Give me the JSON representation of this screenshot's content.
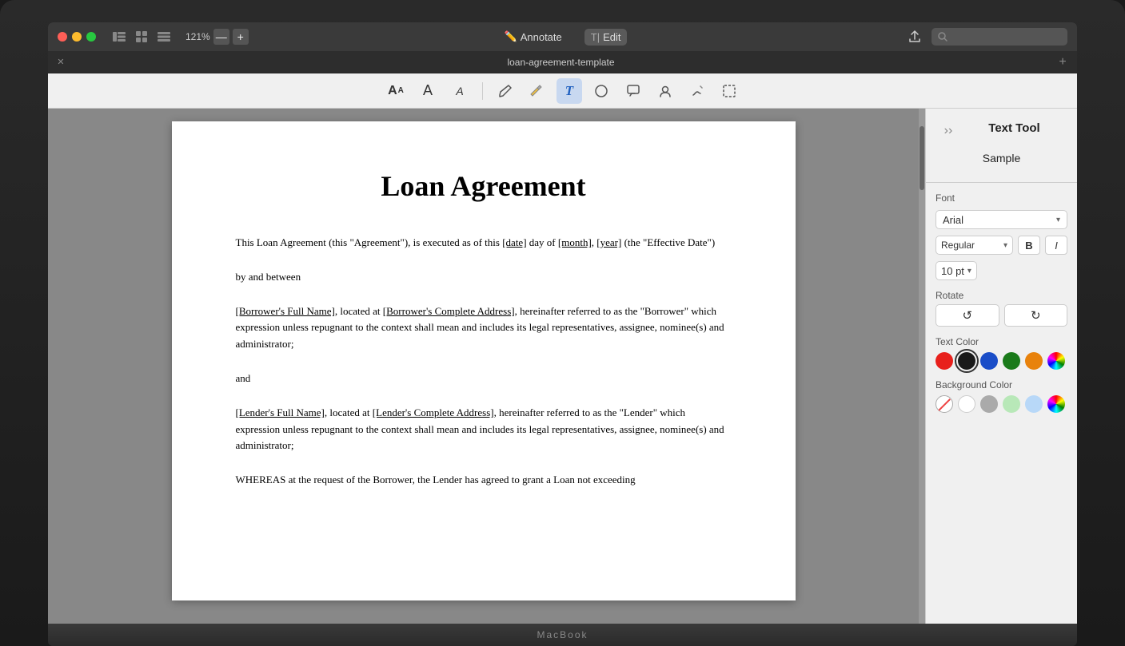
{
  "laptop": {
    "label": "MacBook"
  },
  "titlebar": {
    "zoom_level": "121%",
    "zoom_minus": "—",
    "zoom_plus": "+",
    "annotate_label": "Annotate",
    "edit_label": "Edit",
    "search_placeholder": ""
  },
  "tabbar": {
    "title": "loan-agreement-template",
    "close_label": "✕",
    "add_label": "+"
  },
  "toolbar": {
    "tools": [
      {
        "name": "text-resize-a-icon",
        "symbol": "𝗔",
        "active": false
      },
      {
        "name": "text-a-icon",
        "symbol": "A",
        "active": false
      },
      {
        "name": "text-a-small-icon",
        "symbol": "A",
        "active": false
      },
      {
        "name": "pencil-icon",
        "symbol": "✏",
        "active": false
      },
      {
        "name": "highlighter-icon",
        "symbol": "🖊",
        "active": false
      },
      {
        "name": "text-t-icon",
        "symbol": "T",
        "active": true
      },
      {
        "name": "shapes-icon",
        "symbol": "⬜",
        "active": false
      },
      {
        "name": "comment-icon",
        "symbol": "💬",
        "active": false
      },
      {
        "name": "signature-icon",
        "symbol": "👤",
        "active": false
      },
      {
        "name": "pen-icon",
        "symbol": "✒",
        "active": false
      },
      {
        "name": "selection-icon",
        "symbol": "⊡",
        "active": false
      }
    ]
  },
  "document": {
    "title": "Loan Agreement",
    "paragraphs": [
      {
        "text": "This Loan Agreement (this \"Agreement\"), is executed as of this [date] day of [month], [year] (the \"Effective Date\")",
        "has_underline": [
          "[date]",
          "[month]",
          "[year]"
        ]
      },
      {
        "text": "by and between"
      },
      {
        "text": "[Borrower's Full Name], located at [Borrower's Complete Address], hereinafter referred to as the \"Borrower\" which expression unless repugnant to the context shall mean and includes its legal representatives, assignee, nominee(s) and administrator;",
        "has_underline": [
          "[Borrower's Full Name]",
          "[Borrower's Complete Address]"
        ]
      },
      {
        "text": "and"
      },
      {
        "text": "[Lender's Full Name], located at [Lender's Complete Address], hereinafter referred to as the \"Lender\" which expression unless repugnant to the context shall mean and includes its legal representatives, assignee, nominee(s) and administrator;",
        "has_underline": [
          "[Lender's Full Name]",
          "[Lender's Complete Address]"
        ]
      },
      {
        "text": "WHEREAS at the request of the Borrower, the Lender has agreed to grant a Loan not exceeding"
      }
    ]
  },
  "right_panel": {
    "title": "Text Tool",
    "sample_text": "Sample",
    "font_label": "Font",
    "font_value": "Arial",
    "style_value": "Regular",
    "bold_label": "B",
    "italic_label": "I",
    "size_value": "10 pt",
    "rotate_label": "Rotate",
    "rotate_ccw": "↺",
    "rotate_cw": "↻",
    "text_color_label": "Text Color",
    "text_colors": [
      {
        "color": "#e8201c",
        "selected": false,
        "name": "red"
      },
      {
        "color": "#1a1a1a",
        "selected": true,
        "name": "black"
      },
      {
        "color": "#1a4dc8",
        "selected": false,
        "name": "blue"
      },
      {
        "color": "#1a7a1a",
        "selected": false,
        "name": "green"
      },
      {
        "color": "#e8820c",
        "selected": false,
        "name": "orange"
      },
      {
        "color": "multicolor",
        "selected": false,
        "name": "multicolor"
      }
    ],
    "bg_color_label": "Background Color",
    "bg_colors": [
      {
        "color": "none",
        "selected": false,
        "name": "none"
      },
      {
        "color": "#ffffff",
        "selected": false,
        "name": "white"
      },
      {
        "color": "#aaaaaa",
        "selected": false,
        "name": "gray"
      },
      {
        "color": "#b8e8b8",
        "selected": false,
        "name": "light-green"
      },
      {
        "color": "#b8d8f8",
        "selected": false,
        "name": "light-blue"
      },
      {
        "color": "multicolor",
        "selected": false,
        "name": "multicolor"
      }
    ]
  }
}
